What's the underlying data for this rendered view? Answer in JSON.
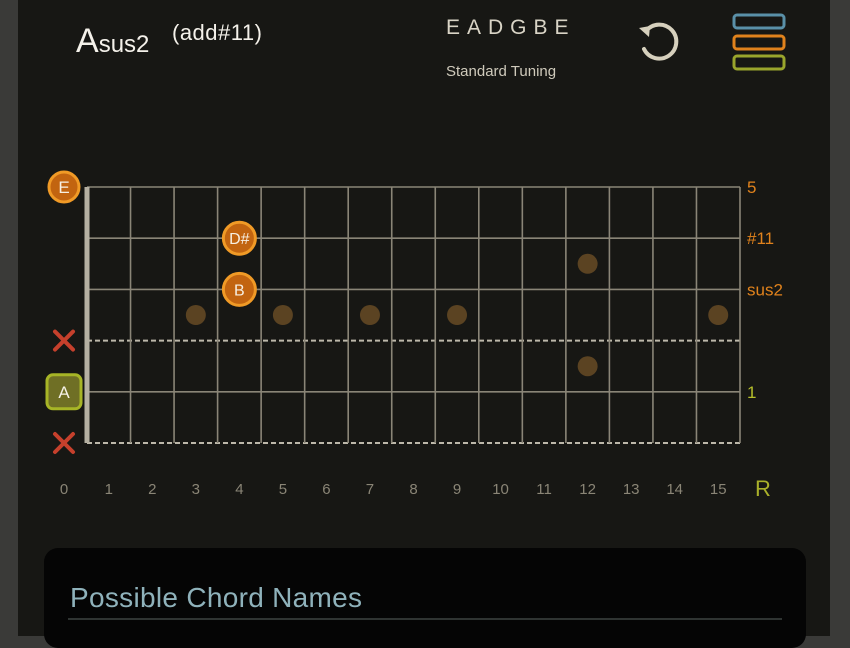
{
  "chord": {
    "root": "A",
    "suffix": "sus2",
    "superscript": "(add#11)"
  },
  "tuning": {
    "notes": "EADGBE",
    "name": "Standard Tuning"
  },
  "toolbar": {
    "reset_icon": "undo-icon",
    "menu_icon": "stacked-bars-menu-icon",
    "menu_colors": [
      "#5a90a8",
      "#e0821c",
      "#9aa52c"
    ]
  },
  "fretboard": {
    "fret_numbers": [
      "0",
      "1",
      "2",
      "3",
      "4",
      "5",
      "6",
      "7",
      "8",
      "9",
      "10",
      "11",
      "12",
      "13",
      "14",
      "15"
    ],
    "root_label": "R",
    "inlays_single": [
      3,
      5,
      7,
      9,
      15
    ],
    "inlays_double": [
      12
    ],
    "strings": [
      {
        "open": "E",
        "open_type": "note",
        "interval": "5",
        "interval_color": "#e0821c"
      },
      {
        "open": "",
        "open_type": "none",
        "interval": "#11",
        "interval_color": "#e0821c"
      },
      {
        "open": "",
        "open_type": "none",
        "interval": "sus2",
        "interval_color": "#e0821c"
      },
      {
        "open": "",
        "open_type": "muted",
        "interval": "",
        "interval_color": ""
      },
      {
        "open": "A",
        "open_type": "root",
        "interval": "1",
        "interval_color": "#b6bf2a"
      },
      {
        "open": "",
        "open_type": "muted",
        "interval": "",
        "interval_color": ""
      }
    ],
    "fretted_notes": [
      {
        "string": 1,
        "fret": 4,
        "label": "D#"
      },
      {
        "string": 2,
        "fret": 4,
        "label": "B"
      }
    ],
    "colors": {
      "note_fill": "#c26410",
      "note_ring": "#f09a26",
      "root_ring": "#a7b526",
      "mute": "#c6402c",
      "inlay": "#5b4322",
      "fret_line": "#8a8577"
    }
  },
  "chord_names": {
    "title": "Possible Chord Names"
  }
}
